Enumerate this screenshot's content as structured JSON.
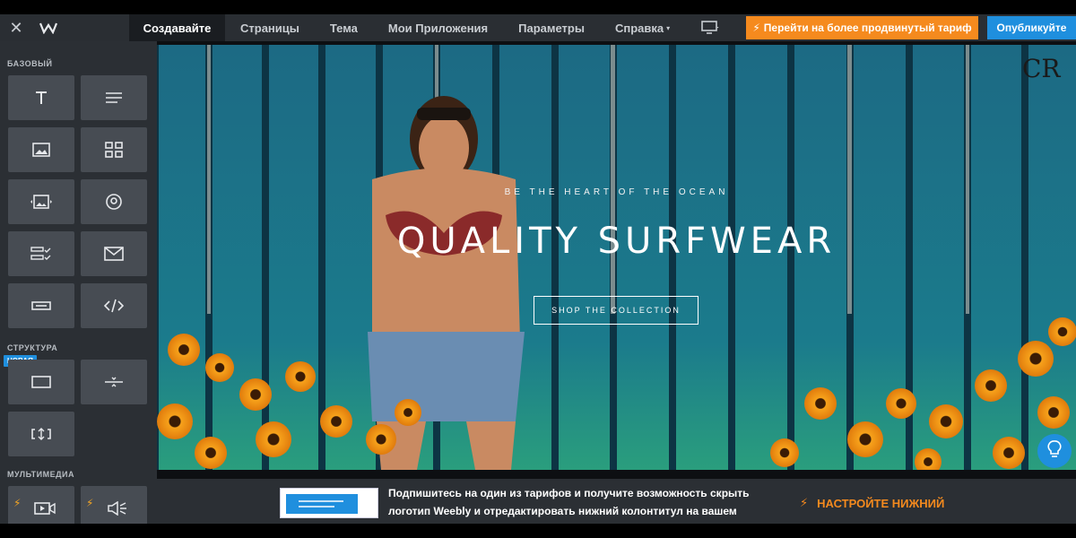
{
  "topbar": {
    "close_icon": "close-icon",
    "logo_icon": "weebly-logo-icon",
    "nav": [
      {
        "label": "Создавайте",
        "active": true
      },
      {
        "label": "Страницы"
      },
      {
        "label": "Тема"
      },
      {
        "label": "Мои Приложения"
      },
      {
        "label": "Параметры"
      },
      {
        "label": "Справка"
      }
    ],
    "device_icon": "monitor-icon",
    "upgrade_label": "Перейти на более продвинутый тариф",
    "publish_label": "Опубликуйте",
    "accent_orange": "#f58a1e",
    "accent_blue": "#1f8fde"
  },
  "sidebar": {
    "section_basic": "БАЗОВЫЙ",
    "section_structure": "СТРУКТУРА",
    "section_media": "МУЛЬТИМЕДИА",
    "badge_new": "НОВАЯ",
    "basic_tiles": [
      "title-icon",
      "text-icon",
      "image-icon",
      "gallery-icon",
      "slideshow-icon",
      "map-icon",
      "form-icon",
      "contact-form-icon",
      "button-icon",
      "embed-code-icon"
    ],
    "structure_tiles": [
      "section-icon",
      "divider-icon",
      "spacer-icon"
    ],
    "media_tiles": [
      "video-icon",
      "audio-icon"
    ]
  },
  "hero": {
    "tagline": "BE THE HEART OF THE OCEAN",
    "title": "QUALITY SURFWEAR",
    "button": "SHOP THE COLLECTION",
    "logo_text": "CR"
  },
  "banner": {
    "text": "Подпишитесь на один из тарифов и получите возможность скрыть логотип Weebly и отредактировать нижний колонтитул на вашем сайте.",
    "cta": "НАСТРОЙТЕ НИЖНИЙ"
  }
}
